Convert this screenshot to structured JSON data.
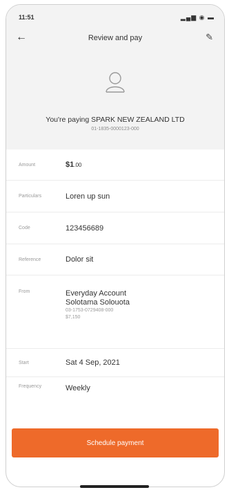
{
  "status": {
    "time": "11:51",
    "icons": "▂▄▆ ◉ ▬"
  },
  "header": {
    "title": "Review and pay"
  },
  "payee": {
    "text": "You're paying SPARK NEW ZEALAND LTD",
    "account": "01-1835-0000123-000"
  },
  "fields": {
    "amount": {
      "label": "Amount",
      "value": "$1",
      "cents": ".00"
    },
    "particulars": {
      "label": "Particulars",
      "value": "Loren up sun"
    },
    "code": {
      "label": "Code",
      "value": "123456689"
    },
    "reference": {
      "label": "Reference",
      "value": "Dolor sit"
    },
    "from": {
      "label": "From",
      "account_name": "Everyday Account",
      "holder": "Solotama Solouota",
      "number": "03-1753-0729408-000",
      "balance": "$7,150"
    },
    "start": {
      "label": "Start",
      "value": "Sat 4 Sep, 2021"
    },
    "frequency": {
      "label": "Frequency",
      "value": "Weekly"
    }
  },
  "cta": {
    "label": "Schedule payment"
  },
  "colors": {
    "accent": "#ee6a2a",
    "header_bg": "#f3f3f3"
  },
  "icons": {
    "back": "arrow-left-icon",
    "edit": "pencil-icon",
    "avatar": "user-avatar-icon"
  }
}
